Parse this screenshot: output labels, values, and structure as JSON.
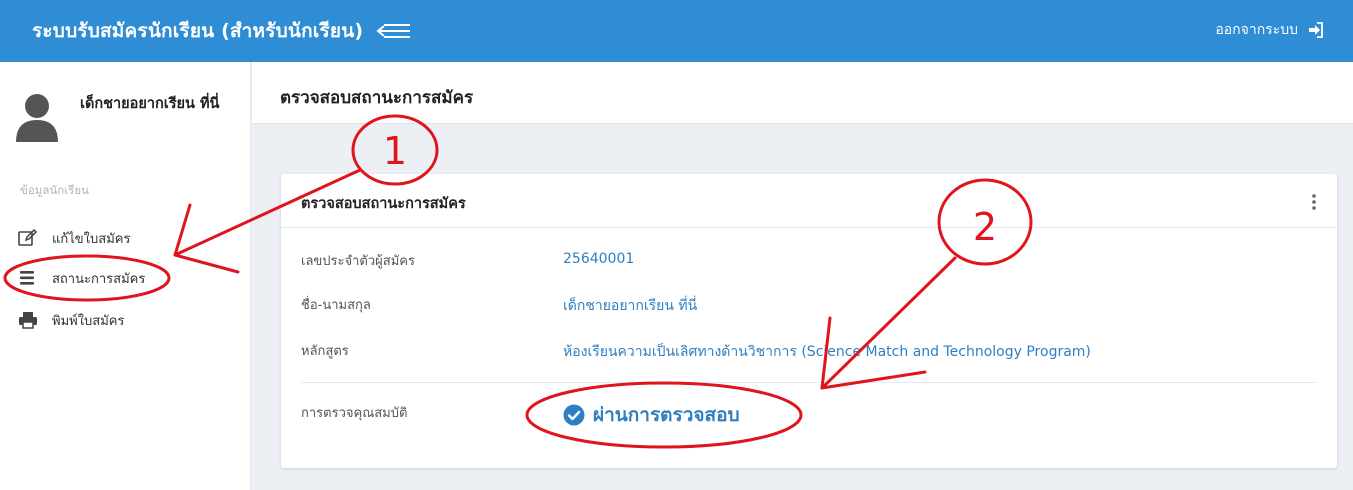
{
  "header": {
    "app_title": "ระบบรับสมัครนักเรียน (สำหรับนักเรียน)",
    "logout_label": "ออกจากระบบ"
  },
  "sidebar": {
    "user_name": "เด็กชายอยากเรียน ที่นี่",
    "section_label": "ข้อมูลนักเรียน",
    "items": [
      {
        "label": "แก้ไขใบสมัคร",
        "icon": "edit-icon"
      },
      {
        "label": "สถานะการสมัคร",
        "icon": "list-icon"
      },
      {
        "label": "พิมพ์ใบสมัคร",
        "icon": "print-icon"
      }
    ]
  },
  "page": {
    "title": "ตรวจสอบสถานะการสมัคร"
  },
  "card": {
    "title": "ตรวจสอบสถานะการสมัคร",
    "rows": [
      {
        "label": "เลขประจำตัวผู้สมัคร",
        "value": "25640001"
      },
      {
        "label": "ชื่อ-นามสกุล",
        "value": "เด็กชายอยากเรียน ที่นี่"
      },
      {
        "label": "หลักสูตร",
        "value": "ห้องเรียนความเป็นเลิศทางด้านวิชาการ (Science Match and Technology Program)"
      }
    ],
    "status_label": "การตรวจคุณสมบัติ",
    "status_value": "ผ่านการตรวจสอบ"
  },
  "annotations": {
    "marker_1": "1",
    "marker_2": "2"
  },
  "colors": {
    "header_bg": "#2f8dd6",
    "link": "#2f7fc1",
    "annotation": "#e0141c"
  }
}
